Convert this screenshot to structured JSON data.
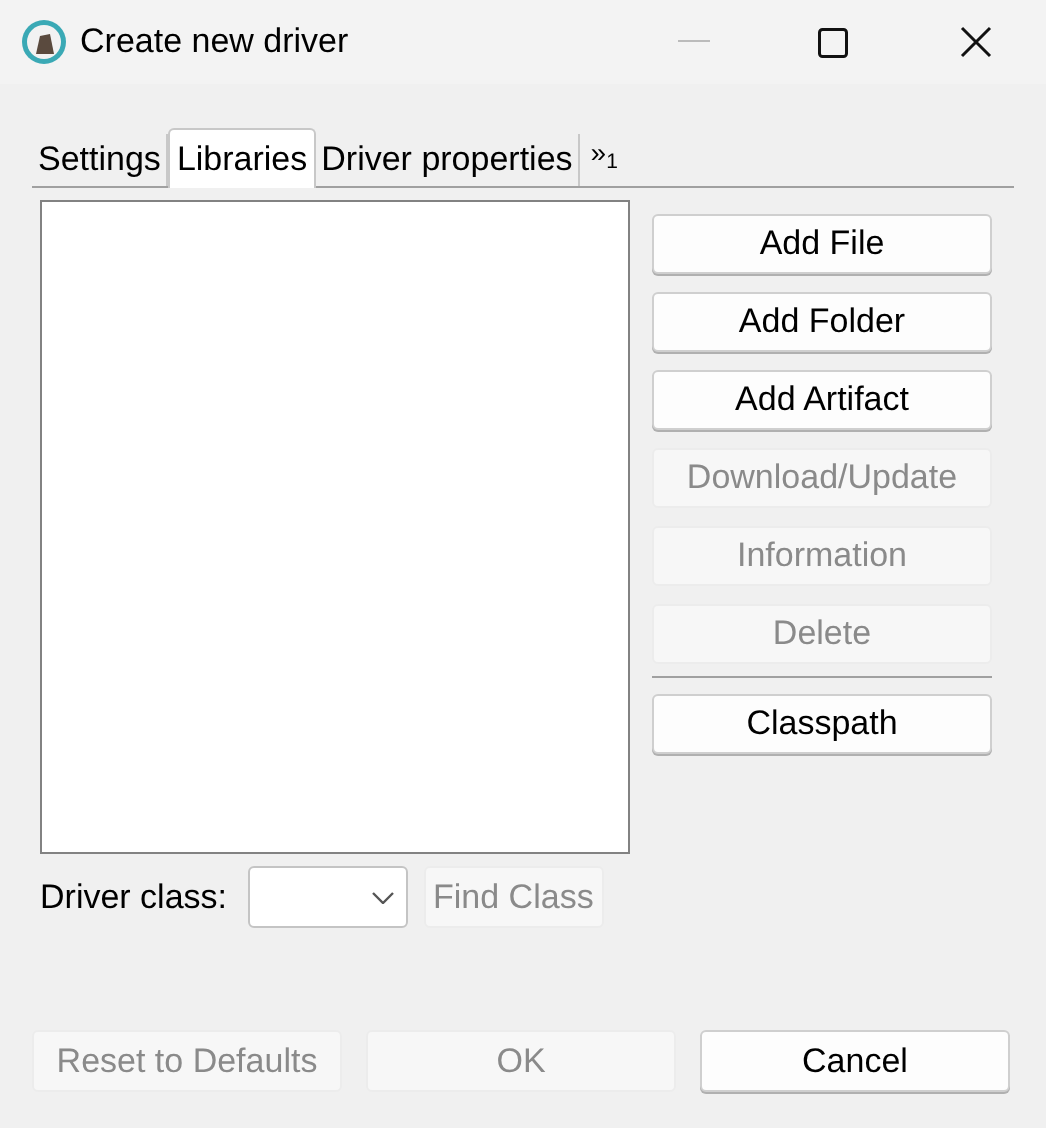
{
  "window": {
    "title": "Create new driver"
  },
  "tabs": [
    {
      "label": "Settings",
      "selected": false
    },
    {
      "label": "Libraries",
      "selected": true
    },
    {
      "label": "Driver properties",
      "selected": false
    }
  ],
  "tab_overflow": "»$_{1}$",
  "side_buttons": [
    {
      "label": "Add File",
      "disabled": false
    },
    {
      "label": "Add Folder",
      "disabled": false
    },
    {
      "label": "Add Artifact",
      "disabled": false
    },
    {
      "label": "Download/Update",
      "disabled": true
    },
    {
      "label": "Information",
      "disabled": true
    },
    {
      "label": "Delete",
      "disabled": true
    },
    {
      "label": "Classpath",
      "disabled": false,
      "separator_before": true
    }
  ],
  "driver_class": {
    "label": "Driver class:",
    "find_button": {
      "label": "Find Class",
      "disabled": true
    }
  },
  "footer_buttons": [
    {
      "label": "Reset to Defaults",
      "disabled": true
    },
    {
      "label": "OK",
      "disabled": true
    },
    {
      "label": "Cancel",
      "disabled": false
    }
  ]
}
